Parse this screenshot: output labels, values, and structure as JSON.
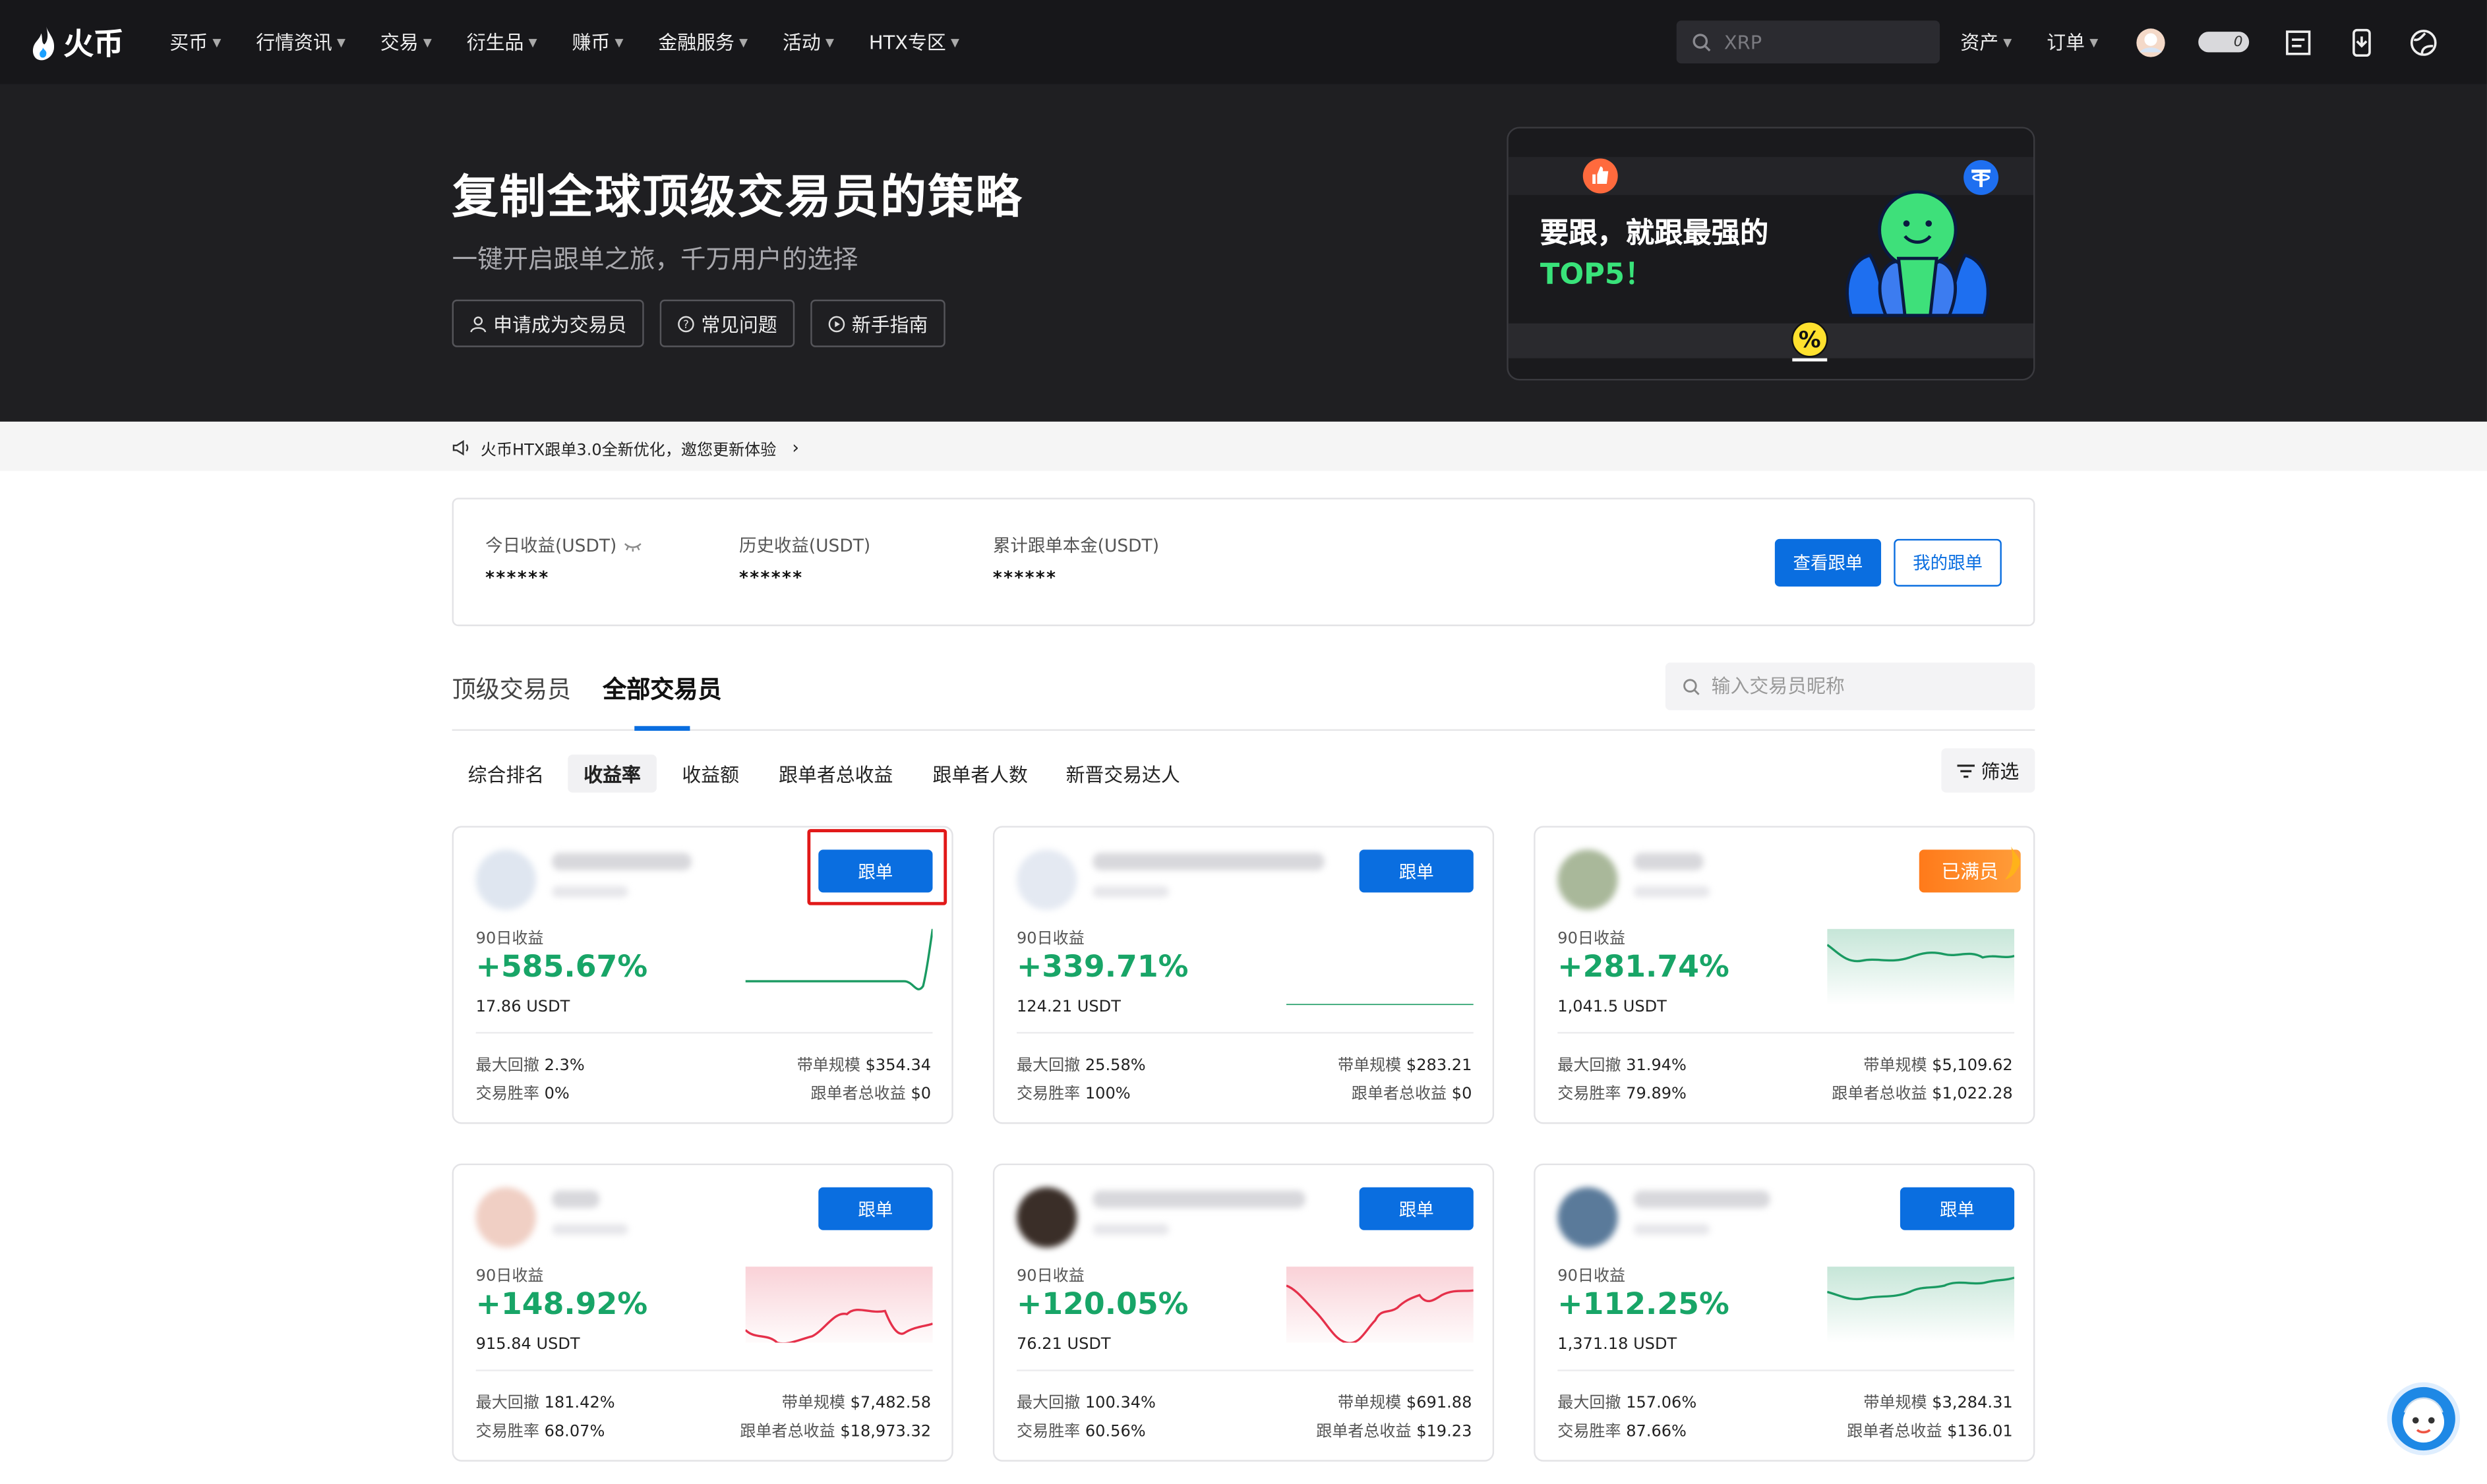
{
  "nav": {
    "logo_text": "火币",
    "menu": [
      "买币",
      "行情资讯",
      "交易",
      "衍生品",
      "赚币",
      "金融服务",
      "活动",
      "HTX专区"
    ],
    "search_placeholder": "XRP",
    "assets": "资产",
    "orders": "订单",
    "toggle_label": "0"
  },
  "hero": {
    "title": "复制全球顶级交易员的策略",
    "subtitle": "一键开启跟单之旅，千万用户的选择",
    "buttons": [
      "申请成为交易员",
      "常见问题",
      "新手指南"
    ],
    "banner_line1": "要跟，就跟最强的",
    "banner_line2": "TOP5！"
  },
  "notice": "火币HTX跟单3.0全新优化，邀您更新体验",
  "summary": {
    "items": [
      {
        "label": "今日收益(USDT)",
        "value": "******"
      },
      {
        "label": "历史收益(USDT)",
        "value": "******"
      },
      {
        "label": "累计跟单本金(USDT)",
        "value": "******"
      }
    ],
    "view_button": "查看跟单",
    "my_button": "我的跟单"
  },
  "tabs": [
    "顶级交易员",
    "全部交易员"
  ],
  "trader_search_placeholder": "输入交易员昵称",
  "sort_options": [
    "综合排名",
    "收益率",
    "收益额",
    "跟单者总收益",
    "跟单者人数",
    "新晋交易达人"
  ],
  "filter_label": "筛选",
  "card_labels": {
    "ninety_day": "90日收益",
    "max_drawdown": "最大回撤",
    "win_rate": "交易胜率",
    "scale": "带单规模",
    "followers_profit": "跟单者总收益",
    "follow_button": "跟单",
    "full_badge": "已满员"
  },
  "traders": [
    {
      "pct": "+585.67%",
      "usdt": "17.86 USDT",
      "drawdown": "2.3%",
      "win": "0%",
      "scale": "$354.34",
      "profit": "$0",
      "status": "follow"
    },
    {
      "pct": "+339.71%",
      "usdt": "124.21 USDT",
      "drawdown": "25.58%",
      "win": "100%",
      "scale": "$283.21",
      "profit": "$0",
      "status": "follow"
    },
    {
      "pct": "+281.74%",
      "usdt": "1,041.5 USDT",
      "drawdown": "31.94%",
      "win": "79.89%",
      "scale": "$5,109.62",
      "profit": "$1,022.28",
      "status": "full"
    },
    {
      "pct": "+148.92%",
      "usdt": "915.84 USDT",
      "drawdown": "181.42%",
      "win": "68.07%",
      "scale": "$7,482.58",
      "profit": "$18,973.32",
      "status": "follow"
    },
    {
      "pct": "+120.05%",
      "usdt": "76.21 USDT",
      "drawdown": "100.34%",
      "win": "60.56%",
      "scale": "$691.88",
      "profit": "$19.23",
      "status": "follow"
    },
    {
      "pct": "+112.25%",
      "usdt": "1,371.18 USDT",
      "drawdown": "157.06%",
      "win": "87.66%",
      "scale": "$3,284.31",
      "profit": "$136.01",
      "status": "follow"
    }
  ],
  "colors": {
    "primary": "#0a6ee0",
    "gain": "#18a567",
    "loss": "#e5304a",
    "highlight": "#e11919"
  }
}
